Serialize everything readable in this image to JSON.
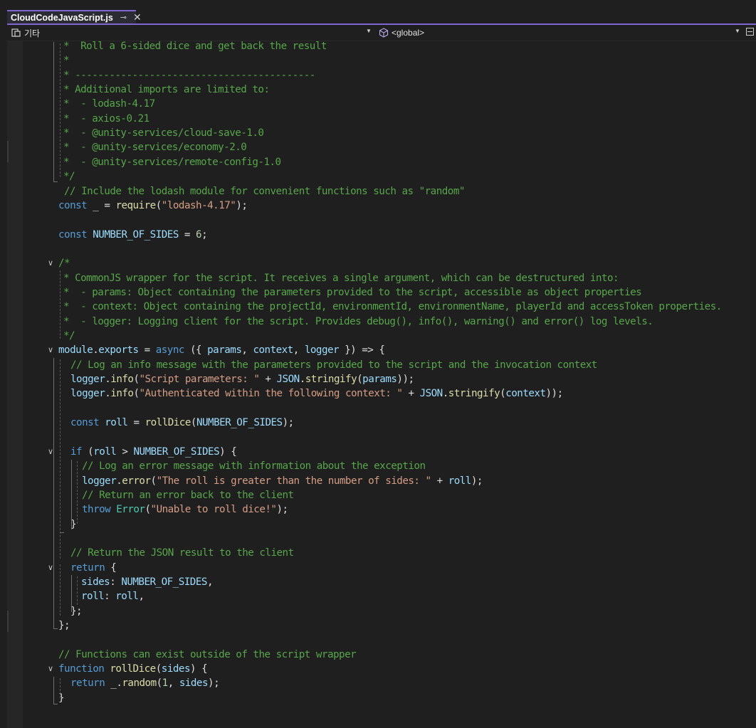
{
  "tab": {
    "title": "CloudCodeJavaScript.js"
  },
  "navbar": {
    "project": "기타",
    "scope": "<global>"
  },
  "lines": [
    [
      [
        "c",
        "*  Roll a 6-sided dice and get back the result"
      ]
    ],
    [
      [
        "c",
        "*"
      ]
    ],
    [
      [
        "c",
        "* ------------------------------------------"
      ]
    ],
    [
      [
        "c",
        "* Additional imports are limited to:"
      ]
    ],
    [
      [
        "c",
        "*  - lodash-4.17"
      ]
    ],
    [
      [
        "c",
        "*  - axios-0.21"
      ]
    ],
    [
      [
        "c",
        "*  - @unity-services/cloud-save-1.0"
      ]
    ],
    [
      [
        "c",
        "*  - @unity-services/economy-2.0"
      ]
    ],
    [
      [
        "c",
        "*  - @unity-services/remote-config-1.0"
      ]
    ],
    [
      [
        "c",
        "*/"
      ]
    ],
    [
      [
        "c",
        "// Include the lodash module for convenient functions such as \"random\""
      ]
    ],
    [
      [
        "k",
        "const"
      ],
      [
        "d",
        " _ = "
      ],
      [
        "f",
        "require"
      ],
      [
        "d",
        "("
      ],
      [
        "s",
        "\"lodash-4.17\""
      ],
      [
        "d",
        ");"
      ]
    ],
    [],
    [
      [
        "k",
        "const"
      ],
      [
        "d",
        " "
      ],
      [
        "v",
        "NUMBER_OF_SIDES"
      ],
      [
        "d",
        " = "
      ],
      [
        "n",
        "6"
      ],
      [
        "d",
        ";"
      ]
    ],
    [],
    [
      [
        "c",
        "/*"
      ]
    ],
    [
      [
        "c",
        "* CommonJS wrapper for the script. It receives a single argument, which can be destructured into:"
      ]
    ],
    [
      [
        "c",
        "*  - params: Object containing the parameters provided to the script, accessible as object properties"
      ]
    ],
    [
      [
        "c",
        "*  - context: Object containing the projectId, environmentId, environmentName, playerId and accessToken properties."
      ]
    ],
    [
      [
        "c",
        "*  - logger: Logging client for the script. Provides debug(), info(), warning() and error() log levels."
      ]
    ],
    [
      [
        "c",
        "*/"
      ]
    ],
    [
      [
        "v",
        "module"
      ],
      [
        "d",
        "."
      ],
      [
        "v",
        "exports"
      ],
      [
        "d",
        " = "
      ],
      [
        "k",
        "async"
      ],
      [
        "d",
        " ({ "
      ],
      [
        "v",
        "params"
      ],
      [
        "d",
        ", "
      ],
      [
        "v",
        "context"
      ],
      [
        "d",
        ", "
      ],
      [
        "v",
        "logger"
      ],
      [
        "d",
        " }) => {"
      ]
    ],
    [
      [
        "c",
        "// Log an info message with the parameters provided to the script and the invocation context"
      ]
    ],
    [
      [
        "v",
        "logger"
      ],
      [
        "d",
        "."
      ],
      [
        "f",
        "info"
      ],
      [
        "d",
        "("
      ],
      [
        "s",
        "\"Script parameters: \""
      ],
      [
        "d",
        " + "
      ],
      [
        "v",
        "JSON"
      ],
      [
        "d",
        "."
      ],
      [
        "f",
        "stringify"
      ],
      [
        "d",
        "("
      ],
      [
        "v",
        "params"
      ],
      [
        "d",
        "));"
      ]
    ],
    [
      [
        "v",
        "logger"
      ],
      [
        "d",
        "."
      ],
      [
        "f",
        "info"
      ],
      [
        "d",
        "("
      ],
      [
        "s",
        "\"Authenticated within the following context: \""
      ],
      [
        "d",
        " + "
      ],
      [
        "v",
        "JSON"
      ],
      [
        "d",
        "."
      ],
      [
        "f",
        "stringify"
      ],
      [
        "d",
        "("
      ],
      [
        "v",
        "context"
      ],
      [
        "d",
        "));"
      ]
    ],
    [],
    [
      [
        "k",
        "const"
      ],
      [
        "d",
        " "
      ],
      [
        "v",
        "roll"
      ],
      [
        "d",
        " = "
      ],
      [
        "f",
        "rollDice"
      ],
      [
        "d",
        "("
      ],
      [
        "v",
        "NUMBER_OF_SIDES"
      ],
      [
        "d",
        ");"
      ]
    ],
    [],
    [
      [
        "k",
        "if"
      ],
      [
        "d",
        " ("
      ],
      [
        "v",
        "roll"
      ],
      [
        "d",
        " > "
      ],
      [
        "v",
        "NUMBER_OF_SIDES"
      ],
      [
        "d",
        ") {"
      ]
    ],
    [
      [
        "c",
        "// Log an error message with information about the exception"
      ]
    ],
    [
      [
        "v",
        "logger"
      ],
      [
        "d",
        "."
      ],
      [
        "f",
        "error"
      ],
      [
        "d",
        "("
      ],
      [
        "s",
        "\"The roll is greater than the number of sides: \""
      ],
      [
        "d",
        " + "
      ],
      [
        "v",
        "roll"
      ],
      [
        "d",
        ");"
      ]
    ],
    [
      [
        "c",
        "// Return an error back to the client"
      ]
    ],
    [
      [
        "k",
        "throw"
      ],
      [
        "d",
        " "
      ],
      [
        "t",
        "Error"
      ],
      [
        "d",
        "("
      ],
      [
        "s",
        "\"Unable to roll dice!\""
      ],
      [
        "d",
        ");"
      ]
    ],
    [
      [
        "d",
        "}"
      ]
    ],
    [],
    [
      [
        "c",
        "// Return the JSON result to the client"
      ]
    ],
    [
      [
        "k",
        "return"
      ],
      [
        "d",
        " {"
      ]
    ],
    [
      [
        "v",
        "sides"
      ],
      [
        "d",
        ": "
      ],
      [
        "v",
        "NUMBER_OF_SIDES"
      ],
      [
        "d",
        ","
      ]
    ],
    [
      [
        "v",
        "roll"
      ],
      [
        "d",
        ": "
      ],
      [
        "v",
        "roll"
      ],
      [
        "d",
        ","
      ]
    ],
    [
      [
        "d",
        "};"
      ]
    ],
    [
      [
        "d",
        "};"
      ]
    ],
    [],
    [
      [
        "c",
        "// Functions can exist outside of the script wrapper"
      ]
    ],
    [
      [
        "k",
        "function"
      ],
      [
        "d",
        " "
      ],
      [
        "f",
        "rollDice"
      ],
      [
        "d",
        "("
      ],
      [
        "v",
        "sides"
      ],
      [
        "d",
        ") {"
      ]
    ],
    [
      [
        "k",
        "return"
      ],
      [
        "d",
        " _."
      ],
      [
        "f",
        "random"
      ],
      [
        "d",
        "("
      ],
      [
        "n",
        "1"
      ],
      [
        "d",
        ", "
      ],
      [
        "v",
        "sides"
      ],
      [
        "d",
        ");"
      ]
    ],
    [
      [
        "d",
        "}"
      ]
    ]
  ]
}
